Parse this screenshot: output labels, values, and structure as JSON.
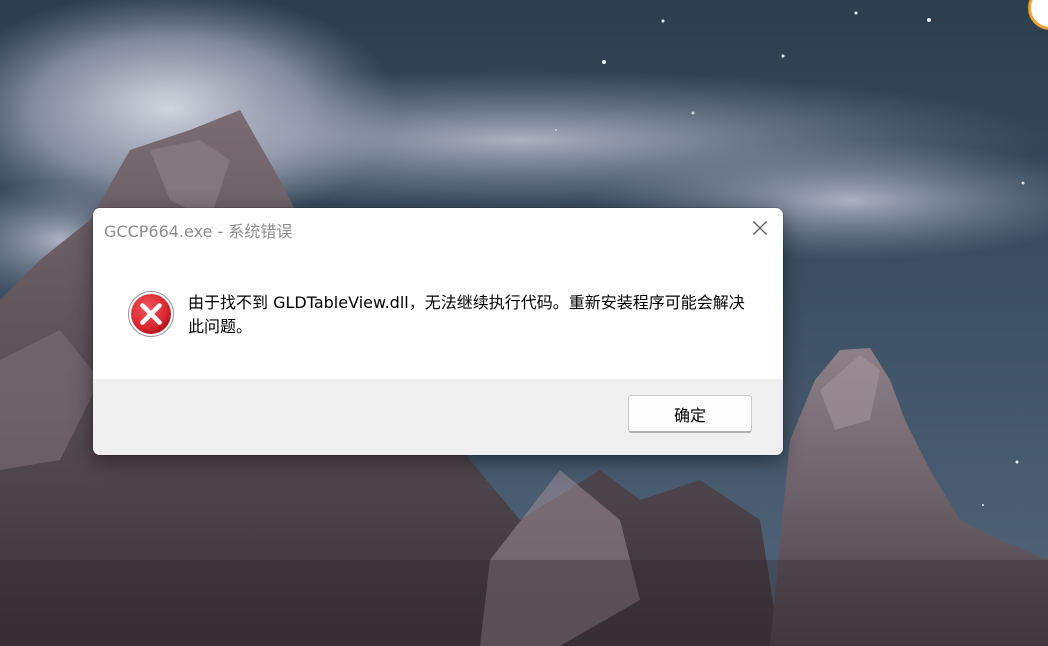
{
  "dialog": {
    "title": "GCCP664.exe - 系统错误",
    "message": "由于找不到 GLDTableView.dll，无法继续执行代码。重新安装程序可能会解决此问题。",
    "ok_label": "确定",
    "icons": {
      "error": "error-x-icon",
      "close": "close-icon"
    }
  },
  "colors": {
    "error_red": "#d9282f",
    "footer_bg": "#f0f0f0",
    "title_text": "#8c8c8c"
  }
}
